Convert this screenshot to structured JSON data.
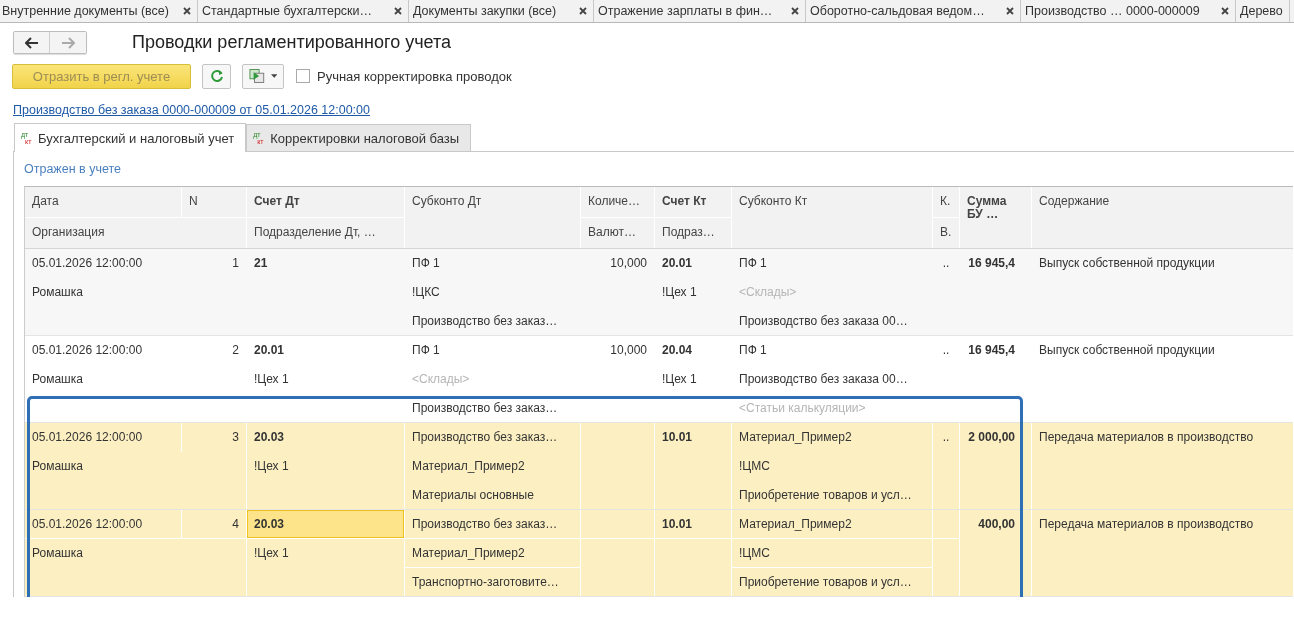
{
  "window_tabs": [
    {
      "title": "Внутренние документы (все)",
      "closable": true
    },
    {
      "title": "Стандартные бухгалтерски…",
      "closable": true
    },
    {
      "title": "Документы закупки (все)",
      "closable": true
    },
    {
      "title": "Отражение зарплаты в фин…",
      "closable": true
    },
    {
      "title": "Оборотно-сальдовая ведом…",
      "closable": true
    },
    {
      "title": "Производство …  0000-000009",
      "closable": true
    },
    {
      "title": "Дерево",
      "closable": false
    }
  ],
  "title": "Проводки регламентированного учета",
  "toolbar": {
    "post_button": {
      "label": "Отразить в регл. учете",
      "disabled": true
    },
    "manual_checkbox": {
      "label": "Ручная корректировка проводок",
      "checked": false
    }
  },
  "document_link": "Производство без заказа 0000-000009 от 05.01.2026 12:00:00",
  "form_tabs": [
    {
      "label": "Бухгалтерский и налоговый учет",
      "icon_top": "дт",
      "icon_bottom": "кт",
      "selected": true
    },
    {
      "label": "Корректировки налоговой базы",
      "icon_top": "дт",
      "icon_bottom": "кт",
      "selected": false
    }
  ],
  "status": "Отражен в учете",
  "table": {
    "columns": [
      {
        "text": "Дата",
        "bold": false
      },
      {
        "text": "N",
        "bold": false
      },
      {
        "text": "Счет Дт",
        "bold": true
      },
      {
        "text": "Субконто Дт",
        "bold": false
      },
      {
        "text": "Количе…",
        "bold": false
      },
      {
        "text": "Счет Кт",
        "bold": true
      },
      {
        "text": "Субконто Кт",
        "bold": false
      },
      {
        "text": "К.",
        "bold": false
      },
      {
        "text": "Сумма БУ …",
        "bold": true
      },
      {
        "text": "Содержание",
        "bold": false
      },
      {
        "text": "Организация",
        "bold": false
      },
      {
        "text": "Подразделение Дт, …",
        "bold": false
      },
      {
        "text": "Валют…",
        "bold": false
      },
      {
        "text": "Подраз…",
        "bold": false
      },
      {
        "text": "В.",
        "bold": false
      }
    ],
    "rows": [
      {
        "date": "05.01.2026 12:00:00",
        "n": "1",
        "organization": "Ромашка",
        "account_dt": "21",
        "division_dt": "",
        "subconto_dt": [
          {
            "text": "ПФ 1",
            "placeholder": false
          },
          {
            "text": "!ЦКС",
            "placeholder": false
          },
          {
            "text": "Производство без заказ…",
            "placeholder": false
          }
        ],
        "quantity": "10,000",
        "account_kt": "20.01",
        "division_kt": "!Цех 1",
        "subconto_kt": [
          {
            "text": "ПФ 1",
            "placeholder": false
          },
          {
            "text": "<Склады>",
            "placeholder": true
          },
          {
            "text": "Производство без заказа 00…",
            "placeholder": false
          }
        ],
        "k": "..",
        "sum": "16 945,4",
        "content": "Выпуск собственной продукции",
        "selected": false,
        "focused": false
      },
      {
        "date": "05.01.2026 12:00:00",
        "n": "2",
        "organization": "Ромашка",
        "account_dt": "20.01",
        "division_dt": "!Цех 1",
        "subconto_dt": [
          {
            "text": "ПФ 1",
            "placeholder": false
          },
          {
            "text": "<Склады>",
            "placeholder": true
          },
          {
            "text": "Производство без заказ…",
            "placeholder": false
          }
        ],
        "quantity": "10,000",
        "account_kt": "20.04",
        "division_kt": "!Цех 1",
        "subconto_kt": [
          {
            "text": "ПФ 1",
            "placeholder": false
          },
          {
            "text": "Производство без заказа 00…",
            "placeholder": false
          },
          {
            "text": "<Статьи калькуляции>",
            "placeholder": true
          }
        ],
        "k": "..",
        "sum": "16 945,4",
        "content": "Выпуск собственной продукции",
        "selected": false,
        "focused": false
      },
      {
        "date": "05.01.2026 12:00:00",
        "n": "3",
        "organization": "Ромашка",
        "account_dt": "20.03",
        "division_dt": "!Цех 1",
        "subconto_dt": [
          {
            "text": "Производство без заказ…",
            "placeholder": false
          },
          {
            "text": "Материал_Пример2",
            "placeholder": false
          },
          {
            "text": "Материалы основные",
            "placeholder": false
          }
        ],
        "quantity": "",
        "account_kt": "10.01",
        "division_kt": "",
        "subconto_kt": [
          {
            "text": "Материал_Пример2",
            "placeholder": false
          },
          {
            "text": "!ЦМС",
            "placeholder": false
          },
          {
            "text": "Приобретение товаров и усл…",
            "placeholder": false
          }
        ],
        "k": "..",
        "sum": "2 000,00",
        "content": "Передача материалов в производство",
        "selected": true,
        "focused": false
      },
      {
        "date": "05.01.2026 12:00:00",
        "n": "4",
        "organization": "Ромашка",
        "account_dt": "20.03",
        "division_dt": "!Цех 1",
        "subconto_dt": [
          {
            "text": "Производство без заказ…",
            "placeholder": false
          },
          {
            "text": "Материал_Пример2",
            "placeholder": false
          },
          {
            "text": "Транспортно-заготовите…",
            "placeholder": false
          }
        ],
        "quantity": "",
        "account_kt": "10.01",
        "division_kt": "",
        "subconto_kt": [
          {
            "text": "Материал_Пример2",
            "placeholder": false
          },
          {
            "text": "!ЦМС",
            "placeholder": false
          },
          {
            "text": "Приобретение товаров и усл…",
            "placeholder": false
          }
        ],
        "k": "",
        "sum": "400,00",
        "content": "Передача материалов в производство",
        "selected": true,
        "focused": true
      }
    ]
  },
  "highlight_frame": true
}
